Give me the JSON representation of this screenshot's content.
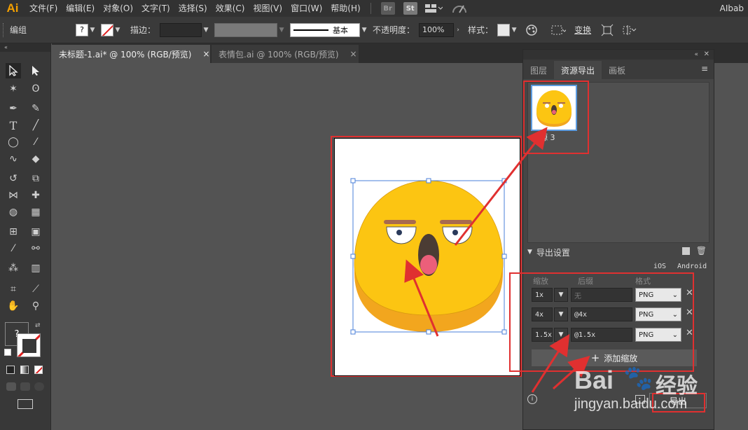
{
  "app": {
    "logo": "Ai",
    "workspace": "AIbab"
  },
  "menu": [
    "文件(F)",
    "编辑(E)",
    "对象(O)",
    "文字(T)",
    "选择(S)",
    "效果(C)",
    "视图(V)",
    "窗口(W)",
    "帮助(H)"
  ],
  "menu_apps": {
    "bridge": "Br",
    "stock": "St"
  },
  "control": {
    "selection_label": "编组",
    "fill_value": "?",
    "stroke_label": "描边：",
    "stroke_style": "基本",
    "opacity_label": "不透明度：",
    "opacity_value": "100%",
    "style_label": "样式：",
    "transform_label": "变换"
  },
  "tabs": [
    {
      "label": "未标题-1.ai* @ 100% (RGB/预览)",
      "close": "×"
    },
    {
      "label": "表情包.ai @ 100% (RGB/预览)",
      "close": "×"
    }
  ],
  "toolbar": {
    "fill_question": "?"
  },
  "panel": {
    "tabs": [
      "图层",
      "资源导出",
      "画板"
    ],
    "asset_name": "资源 3",
    "export_settings_title": "导出设置",
    "platforms": {
      "ios": "iOS",
      "android": "Android"
    },
    "columns": {
      "scale": "缩放",
      "suffix": "后缀",
      "format": "格式"
    },
    "rows": [
      {
        "scale": "1x",
        "suffix": "无",
        "suffix_placeholder": true,
        "format": "PNG"
      },
      {
        "scale": "4x",
        "suffix": "@4x",
        "suffix_placeholder": false,
        "format": "PNG"
      },
      {
        "scale": "1.5x",
        "suffix": "@1.5x",
        "suffix_placeholder": false,
        "format": "PNG"
      }
    ],
    "add_scale": "添加缩放",
    "export_button": "导出"
  },
  "watermark": {
    "brand": "Bai",
    "brand_cn": "经验",
    "url": "jingyan.baidu.com"
  },
  "colors": {
    "annotation_red": "#e03030",
    "emoji_yellow": "#fcc512",
    "emoji_shadow": "#f2a61e",
    "accent_orange": "#f4a000"
  }
}
